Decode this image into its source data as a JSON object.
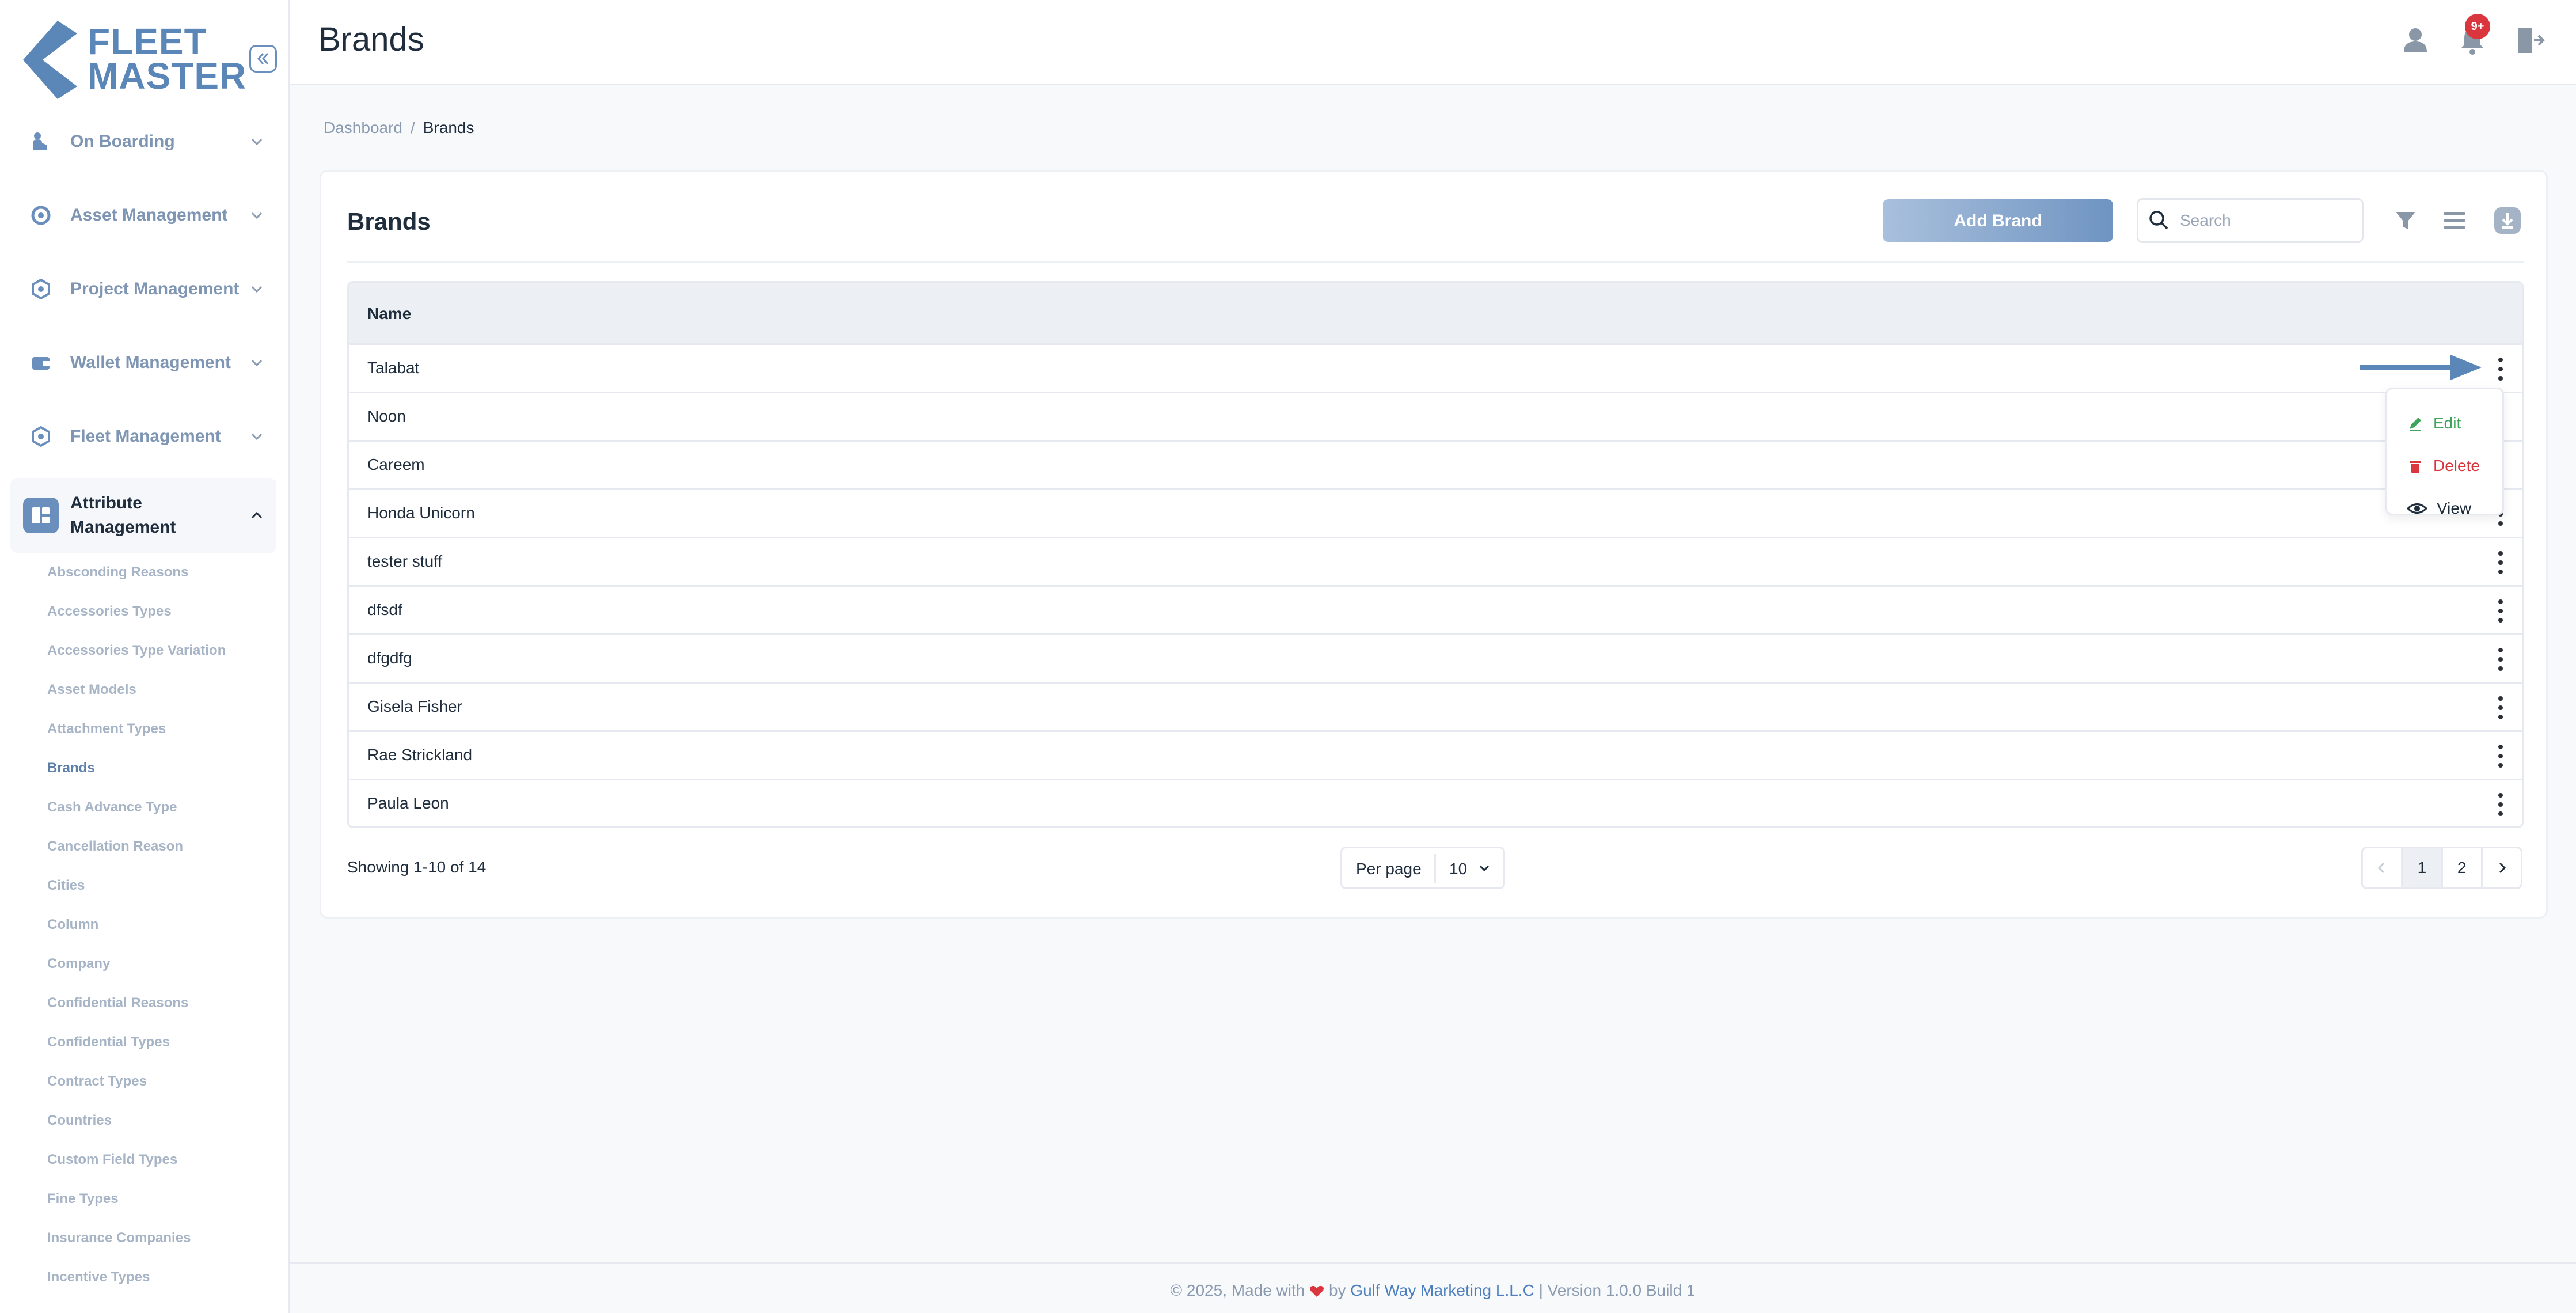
{
  "brand": {
    "logo_line1": "FLEET",
    "logo_line2": "MASTER",
    "accent": "#6b8fbd"
  },
  "sidebar": {
    "collapse_icon": "double-chevron-left-icon",
    "items": [
      {
        "label": "On Boarding",
        "icon": "onboarding-icon",
        "expanded": false
      },
      {
        "label": "Asset Management",
        "icon": "asset-icon",
        "expanded": false
      },
      {
        "label": "Project Management",
        "icon": "project-icon",
        "expanded": false
      },
      {
        "label": "Wallet Management",
        "icon": "wallet-icon",
        "expanded": false
      },
      {
        "label": "Fleet Management",
        "icon": "fleet-icon",
        "expanded": false
      },
      {
        "label_line1": "Attribute",
        "label_line2": "Management",
        "icon": "attribute-icon",
        "expanded": true
      }
    ],
    "subitems": [
      "Absconding Reasons",
      "Accessories Types",
      "Accessories Type Variation",
      "Asset Models",
      "Attachment Types",
      "Brands",
      "Cash Advance Type",
      "Cancellation Reason",
      "Cities",
      "Column",
      "Company",
      "Confidential Reasons",
      "Confidential Types",
      "Contract Types",
      "Countries",
      "Custom Field Types",
      "Fine Types",
      "Insurance Companies",
      "Incentive Types"
    ],
    "active_subitem": "Brands"
  },
  "header": {
    "title": "Brands",
    "notif_badge": "9+"
  },
  "breadcrumb": {
    "home": "Dashboard",
    "separator": "/",
    "current": "Brands"
  },
  "card": {
    "title": "Brands",
    "add_label": "Add Brand",
    "search_placeholder": "Search",
    "column_header": "Name",
    "rows": [
      "Talabat",
      "Noon",
      "Careem",
      "Honda Unicorn",
      "tester stuff",
      "dfsdf",
      "dfgdfg",
      "Gisela Fisher",
      "Rae Strickland",
      "Paula Leon"
    ]
  },
  "row_menu": {
    "edit": "Edit",
    "delete": "Delete",
    "view": "View"
  },
  "pagination": {
    "showing": "Showing 1-10 of 14",
    "per_page_label": "Per page",
    "per_page_value": "10",
    "pages": [
      "1",
      "2"
    ],
    "current_page": "1"
  },
  "footer": {
    "prefix": "© 2025, Made with",
    "by": "by",
    "company": "Gulf Way Marketing L.L.C",
    "suffix": "| Version 1.0.0 Build 1"
  }
}
